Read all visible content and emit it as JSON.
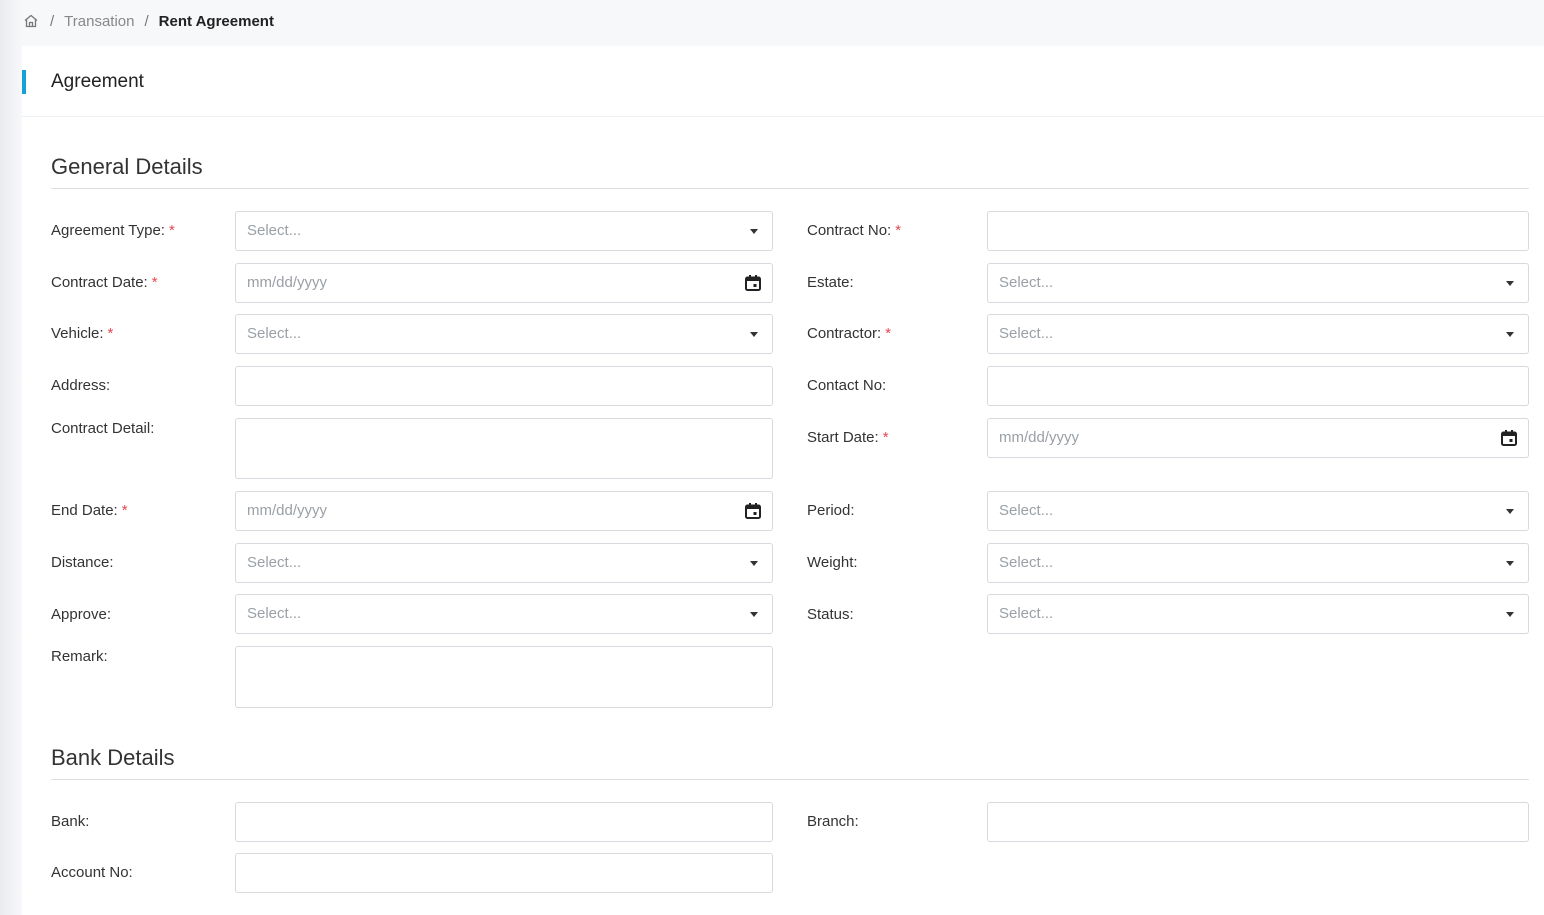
{
  "breadcrumb": {
    "home_icon": "home-icon",
    "separator": "/",
    "items": [
      "Transation",
      "Rent Agreement"
    ]
  },
  "panel": {
    "title": "Agreement"
  },
  "general": {
    "title": "General Details",
    "agreement_type": {
      "label": "Agreement Type:",
      "placeholder": "Select..."
    },
    "contract_no": {
      "label": "Contract No:"
    },
    "contract_date": {
      "label": "Contract Date:",
      "placeholder": "mm/dd/yyyy"
    },
    "estate": {
      "label": "Estate:",
      "placeholder": "Select..."
    },
    "vehicle": {
      "label": "Vehicle:",
      "placeholder": "Select..."
    },
    "contractor": {
      "label": "Contractor:",
      "placeholder": "Select..."
    },
    "address": {
      "label": "Address:"
    },
    "contact_no": {
      "label": "Contact No:"
    },
    "contract_detail": {
      "label": "Contract Detail:"
    },
    "start_date": {
      "label": "Start Date:",
      "placeholder": "mm/dd/yyyy"
    },
    "end_date": {
      "label": "End Date:",
      "placeholder": "mm/dd/yyyy"
    },
    "period": {
      "label": "Period:",
      "placeholder": "Select..."
    },
    "distance": {
      "label": "Distance:",
      "placeholder": "Select..."
    },
    "weight": {
      "label": "Weight:",
      "placeholder": "Select..."
    },
    "approve": {
      "label": "Approve:",
      "placeholder": "Select..."
    },
    "status": {
      "label": "Status:",
      "placeholder": "Select..."
    },
    "remark": {
      "label": "Remark:"
    },
    "required_marker": "*"
  },
  "bank": {
    "title": "Bank Details",
    "bank": {
      "label": "Bank:"
    },
    "branch": {
      "label": "Branch:"
    },
    "account_no": {
      "label": "Account No:"
    }
  },
  "colors": {
    "accent": "#1aa0d8",
    "required": "#e5484d",
    "border": "#d6d9de"
  }
}
